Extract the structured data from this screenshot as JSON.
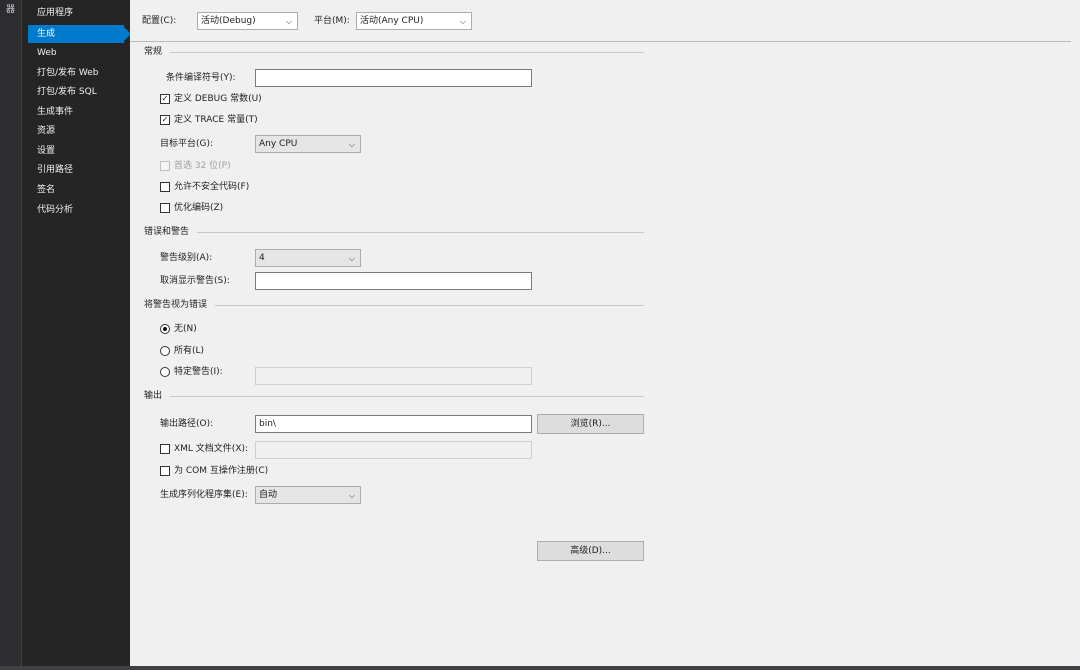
{
  "window": {
    "strip_text": "器"
  },
  "sidebar": {
    "items": [
      {
        "label": "应用程序"
      },
      {
        "label": "生成"
      },
      {
        "label": "Web"
      },
      {
        "label": "打包/发布 Web"
      },
      {
        "label": "打包/发布 SQL"
      },
      {
        "label": "生成事件"
      },
      {
        "label": "资源"
      },
      {
        "label": "设置"
      },
      {
        "label": "引用路径"
      },
      {
        "label": "签名"
      },
      {
        "label": "代码分析"
      }
    ],
    "active_index": 1,
    "accent_color": "#007acc"
  },
  "toolbar": {
    "config_label": "配置(C):",
    "config_value": "活动(Debug)",
    "platform_label": "平台(M):",
    "platform_value": "活动(Any CPU)"
  },
  "general": {
    "title": "常规",
    "symbols_label": "条件编译符号(Y):",
    "symbols_value": "",
    "define_debug_label": "定义 DEBUG 常数(U)",
    "define_debug_checked": true,
    "define_trace_label": "定义 TRACE 常量(T)",
    "define_trace_checked": true,
    "platform_target_label": "目标平台(G):",
    "platform_target_value": "Any CPU",
    "prefer32_label": "首选 32 位(P)",
    "prefer32_checked": false,
    "unsafe_label": "允许不安全代码(F)",
    "unsafe_checked": false,
    "optimize_label": "优化编码(Z)",
    "optimize_checked": false
  },
  "errors": {
    "title": "错误和警告",
    "warning_level_label": "警告级别(A):",
    "warning_level_value": "4",
    "suppress_label": "取消显示警告(S):",
    "suppress_value": ""
  },
  "treat_warnings": {
    "title": "将警告视为错误",
    "none_label": "无(N)",
    "all_label": "所有(L)",
    "specific_label": "特定警告(I):",
    "selected": "none",
    "specific_value": ""
  },
  "output": {
    "title": "输出",
    "path_label": "输出路径(O):",
    "path_value": "bin\\",
    "browse_label": "浏览(R)...",
    "xml_label": "XML 文档文件(X):",
    "xml_checked": false,
    "xml_value": "",
    "com_label": "为 COM 互操作注册(C)",
    "com_checked": false,
    "serialization_label": "生成序列化程序集(E):",
    "serialization_value": "自动"
  },
  "advanced_label": "高级(D)..."
}
